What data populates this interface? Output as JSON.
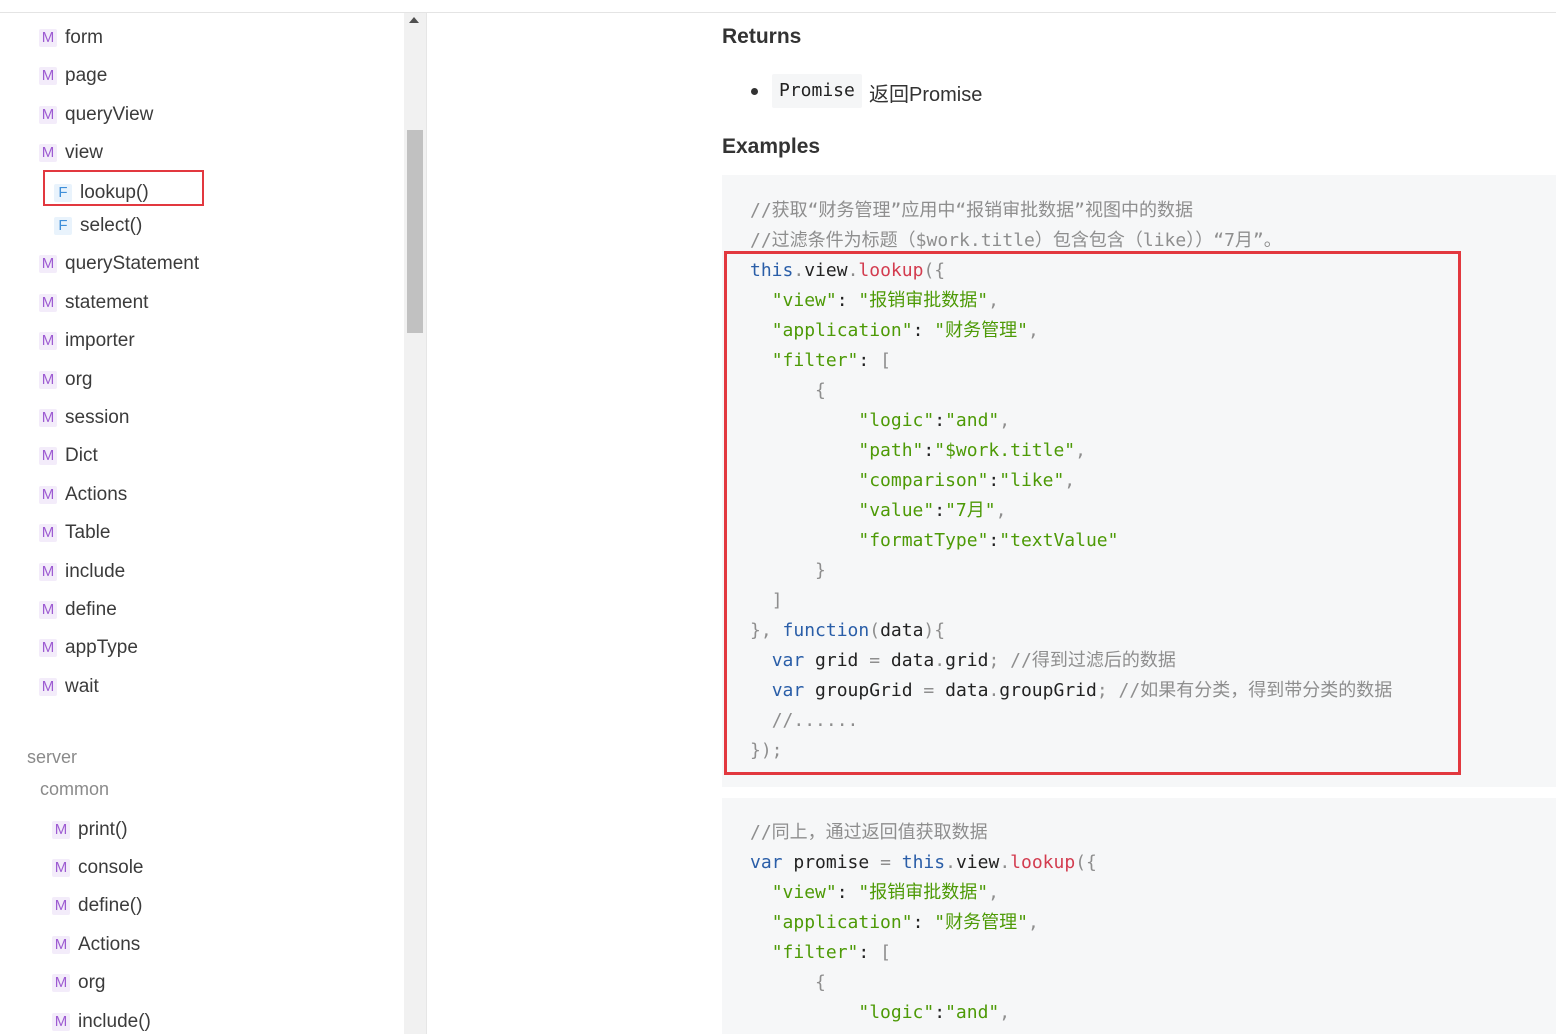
{
  "sidebar": {
    "items": [
      {
        "badge": "M",
        "label": "form"
      },
      {
        "badge": "M",
        "label": "page"
      },
      {
        "badge": "M",
        "label": "queryView"
      },
      {
        "badge": "M",
        "label": "view"
      },
      {
        "badge": "F",
        "label": "lookup()"
      },
      {
        "badge": "F",
        "label": "select()"
      },
      {
        "badge": "M",
        "label": "queryStatement"
      },
      {
        "badge": "M",
        "label": "statement"
      },
      {
        "badge": "M",
        "label": "importer"
      },
      {
        "badge": "M",
        "label": "org"
      },
      {
        "badge": "M",
        "label": "session"
      },
      {
        "badge": "M",
        "label": "Dict"
      },
      {
        "badge": "M",
        "label": "Actions"
      },
      {
        "badge": "M",
        "label": "Table"
      },
      {
        "badge": "M",
        "label": "include"
      },
      {
        "badge": "M",
        "label": "define"
      },
      {
        "badge": "M",
        "label": "appType"
      },
      {
        "badge": "M",
        "label": "wait"
      }
    ],
    "server_title": "server",
    "common_title": "common",
    "common_items": [
      {
        "badge": "M",
        "label": "print()"
      },
      {
        "badge": "M",
        "label": "console"
      },
      {
        "badge": "M",
        "label": "define()"
      },
      {
        "badge": "M",
        "label": "Actions"
      },
      {
        "badge": "M",
        "label": "org"
      },
      {
        "badge": "M",
        "label": "include()"
      }
    ]
  },
  "main": {
    "returns_heading": "Returns",
    "returns_type": "Promise",
    "returns_desc": "返回Promise",
    "examples_heading": "Examples",
    "example1": {
      "lines": [
        [
          [
            "c",
            "//获取“财务管理”应用中“报销审批数据”视图中的数据"
          ]
        ],
        [
          [
            "c",
            "//过滤条件为标题（$work.title）包含包含（like））“7月”。"
          ]
        ],
        [
          [
            "k",
            "this"
          ],
          [
            "p",
            "."
          ],
          [
            "t",
            "view"
          ],
          [
            "p",
            "."
          ],
          [
            "f",
            "lookup"
          ],
          [
            "p",
            "({"
          ]
        ],
        [
          [
            "t",
            "  "
          ],
          [
            "s",
            "\"view\""
          ],
          [
            "t",
            ": "
          ],
          [
            "s",
            "\"报销审批数据\""
          ],
          [
            "p",
            ","
          ]
        ],
        [
          [
            "t",
            "  "
          ],
          [
            "s",
            "\"application\""
          ],
          [
            "t",
            ": "
          ],
          [
            "s",
            "\"财务管理\""
          ],
          [
            "p",
            ","
          ]
        ],
        [
          [
            "t",
            "  "
          ],
          [
            "s",
            "\"filter\""
          ],
          [
            "t",
            ": "
          ],
          [
            "p",
            "["
          ]
        ],
        [
          [
            "t",
            "      "
          ],
          [
            "p",
            "{"
          ]
        ],
        [
          [
            "t",
            "          "
          ],
          [
            "s",
            "\"logic\""
          ],
          [
            "t",
            ":"
          ],
          [
            "s",
            "\"and\""
          ],
          [
            "p",
            ","
          ]
        ],
        [
          [
            "t",
            "          "
          ],
          [
            "s",
            "\"path\""
          ],
          [
            "t",
            ":"
          ],
          [
            "s",
            "\"$work.title\""
          ],
          [
            "p",
            ","
          ]
        ],
        [
          [
            "t",
            "          "
          ],
          [
            "s",
            "\"comparison\""
          ],
          [
            "t",
            ":"
          ],
          [
            "s",
            "\"like\""
          ],
          [
            "p",
            ","
          ]
        ],
        [
          [
            "t",
            "          "
          ],
          [
            "s",
            "\"value\""
          ],
          [
            "t",
            ":"
          ],
          [
            "s",
            "\"7月\""
          ],
          [
            "p",
            ","
          ]
        ],
        [
          [
            "t",
            "          "
          ],
          [
            "s",
            "\"formatType\""
          ],
          [
            "t",
            ":"
          ],
          [
            "s",
            "\"textValue\""
          ]
        ],
        [
          [
            "t",
            "      "
          ],
          [
            "p",
            "}"
          ]
        ],
        [
          [
            "t",
            "  "
          ],
          [
            "p",
            "]"
          ]
        ],
        [
          [
            "p",
            "}, "
          ],
          [
            "k",
            "function"
          ],
          [
            "p",
            "("
          ],
          [
            "t",
            "data"
          ],
          [
            "p",
            "){"
          ]
        ],
        [
          [
            "t",
            "  "
          ],
          [
            "k",
            "var"
          ],
          [
            "t",
            " grid "
          ],
          [
            "p",
            "="
          ],
          [
            "t",
            " data"
          ],
          [
            "p",
            "."
          ],
          [
            "t",
            "grid"
          ],
          [
            "p",
            "; "
          ],
          [
            "c",
            "//得到过滤后的数据"
          ]
        ],
        [
          [
            "t",
            "  "
          ],
          [
            "k",
            "var"
          ],
          [
            "t",
            " groupGrid "
          ],
          [
            "p",
            "="
          ],
          [
            "t",
            " data"
          ],
          [
            "p",
            "."
          ],
          [
            "t",
            "groupGrid"
          ],
          [
            "p",
            "; "
          ],
          [
            "c",
            "//如果有分类，得到带分类的数据"
          ]
        ],
        [
          [
            "t",
            "  "
          ],
          [
            "c",
            "//......"
          ]
        ],
        [
          [
            "p",
            "});"
          ]
        ]
      ]
    },
    "example2": {
      "lines": [
        [
          [
            "c",
            "//同上，通过返回值获取数据"
          ]
        ],
        [
          [
            "k",
            "var"
          ],
          [
            "t",
            " promise "
          ],
          [
            "p",
            "="
          ],
          [
            "t",
            " "
          ],
          [
            "k",
            "this"
          ],
          [
            "p",
            "."
          ],
          [
            "t",
            "view"
          ],
          [
            "p",
            "."
          ],
          [
            "f",
            "lookup"
          ],
          [
            "p",
            "({"
          ]
        ],
        [
          [
            "t",
            "  "
          ],
          [
            "s",
            "\"view\""
          ],
          [
            "t",
            ": "
          ],
          [
            "s",
            "\"报销审批数据\""
          ],
          [
            "p",
            ","
          ]
        ],
        [
          [
            "t",
            "  "
          ],
          [
            "s",
            "\"application\""
          ],
          [
            "t",
            ": "
          ],
          [
            "s",
            "\"财务管理\""
          ],
          [
            "p",
            ","
          ]
        ],
        [
          [
            "t",
            "  "
          ],
          [
            "s",
            "\"filter\""
          ],
          [
            "t",
            ": "
          ],
          [
            "p",
            "["
          ]
        ],
        [
          [
            "t",
            "      "
          ],
          [
            "p",
            "{"
          ]
        ],
        [
          [
            "t",
            "          "
          ],
          [
            "s",
            "\"logic\""
          ],
          [
            "t",
            ":"
          ],
          [
            "s",
            "\"and\""
          ],
          [
            "p",
            ","
          ]
        ]
      ]
    }
  },
  "colors": {
    "highlight_border": "#e2383f",
    "badge_m": "#9d5bd2",
    "badge_f": "#3f8fd9",
    "code_keyword": "#2a5ea8",
    "code_string": "#4d9a06",
    "code_function": "#d33c4f",
    "code_comment": "#8e8e8e"
  }
}
